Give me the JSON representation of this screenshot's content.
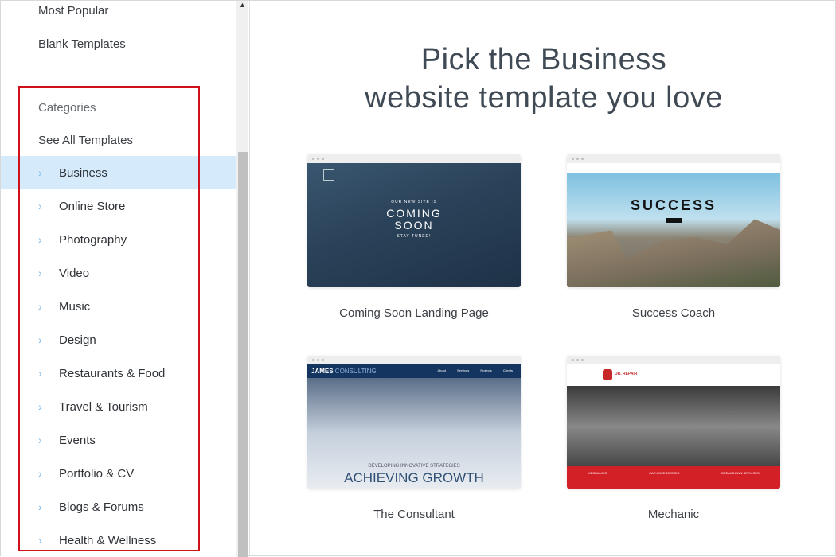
{
  "sidebar": {
    "top_items": [
      "Most Popular",
      "Blank Templates"
    ],
    "categories_label": "Categories",
    "see_all": "See All Templates",
    "categories": [
      "Business",
      "Online Store",
      "Photography",
      "Video",
      "Music",
      "Design",
      "Restaurants & Food",
      "Travel & Tourism",
      "Events",
      "Portfolio & CV",
      "Blogs & Forums",
      "Health & Wellness"
    ],
    "active": "Business",
    "highlight_color": "#d0111b"
  },
  "main": {
    "title_line1": "Pick the Business",
    "title_line2": "website template you love",
    "templates": [
      {
        "name": "Coming Soon Landing Page",
        "preview": {
          "small": "OUR NEW SITE IS",
          "big1": "COMING",
          "big2": "SOON",
          "sub": "STAY TUNED!"
        }
      },
      {
        "name": "Success Coach",
        "preview": {
          "big": "SUCCESS"
        }
      },
      {
        "name": "The Consultant",
        "preview": {
          "brand1": "JAMES",
          "brand2": "CONSULTING",
          "nav": [
            "About",
            "Services",
            "Projects",
            "Clients"
          ],
          "small": "DEVELOPING INNOVATIVE STRATEGIES",
          "big": "ACHIEVING GROWTH"
        }
      },
      {
        "name": "Mechanic",
        "preview": {
          "brand": "DR. REPAIR",
          "cols": [
            "MECHANICS",
            "CAR ACCESSORIES",
            "BREAKDOWN SERVICES"
          ]
        }
      }
    ]
  }
}
